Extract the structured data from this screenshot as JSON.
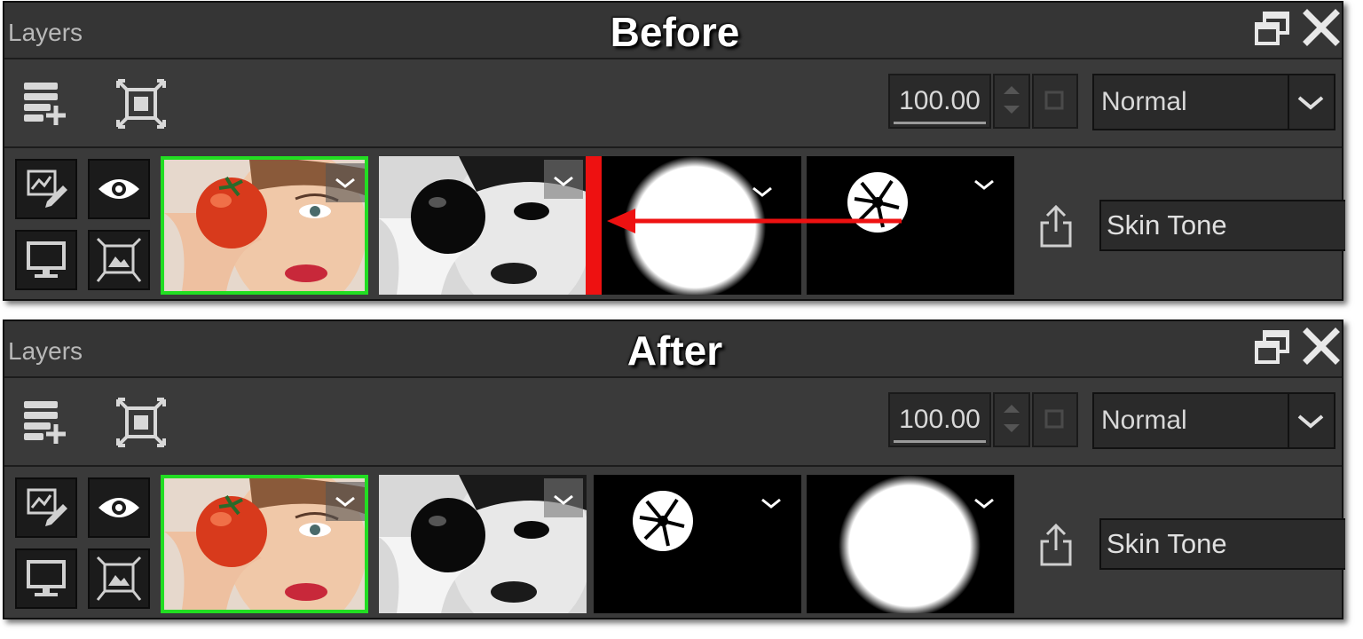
{
  "panels": [
    {
      "title": "Layers",
      "caption": "Before",
      "opacity": "100.00",
      "blend_mode": "Normal",
      "layer_name": "Skin Tone",
      "thumbnails": [
        "tomato-face",
        "bw-face",
        "soft-circle-mask",
        "star-circle-mask"
      ]
    },
    {
      "title": "Layers",
      "caption": "After",
      "opacity": "100.00",
      "blend_mode": "Normal",
      "layer_name": "Skin Tone",
      "thumbnails": [
        "tomato-face",
        "bw-face",
        "star-circle-mask",
        "soft-circle-mask"
      ]
    }
  ],
  "colors": {
    "selected_border": "#22dd22",
    "drag_indicator": "#ee1111",
    "panel_bg": "#3a3a3a"
  },
  "icons": [
    "restore-icon",
    "close-icon",
    "add-layer-icon",
    "fit-frame-icon",
    "edit-mask-icon",
    "eye-icon",
    "monitor-icon",
    "image-frame-icon",
    "share-icon",
    "chevron-down-icon"
  ]
}
